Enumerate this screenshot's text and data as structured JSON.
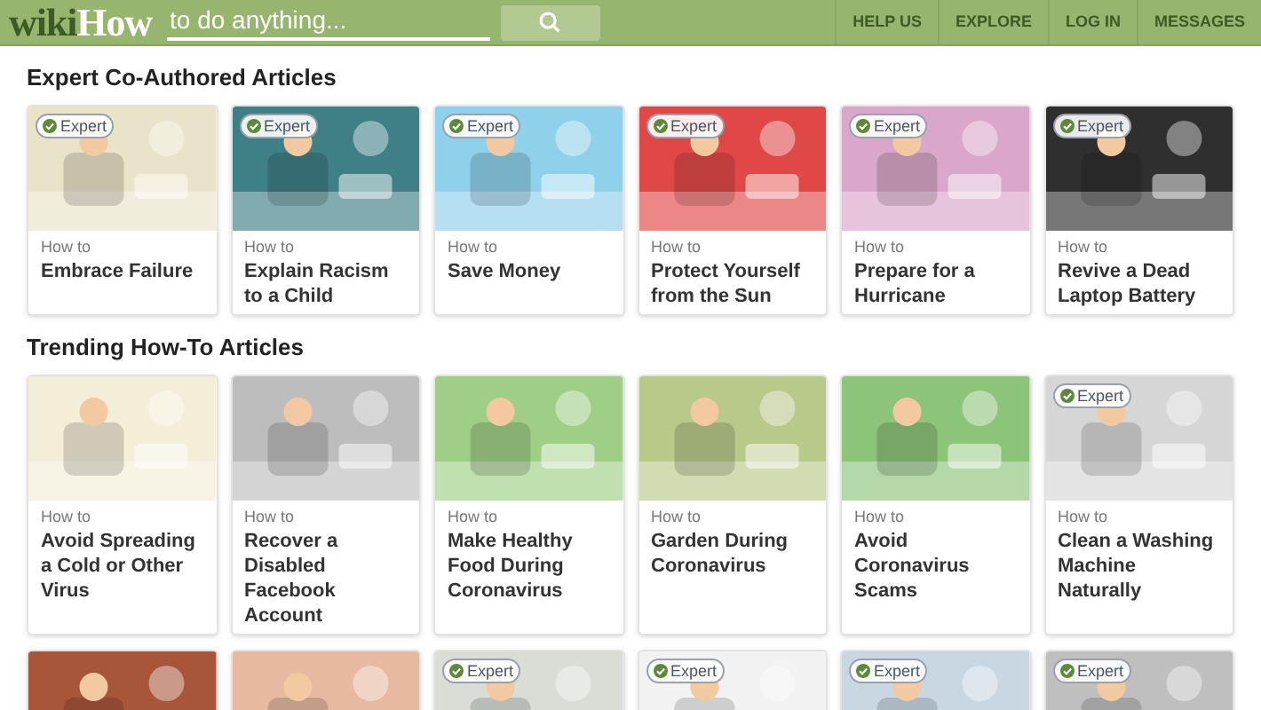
{
  "header": {
    "logo_dark": "wiki",
    "logo_light": "How",
    "search": {
      "placeholder": "to do anything..."
    },
    "nav": [
      "HELP US",
      "EXPLORE",
      "LOG IN",
      "MESSAGES"
    ]
  },
  "sections": [
    {
      "title": "Expert Co-Authored Articles",
      "cards": [
        {
          "image": {
            "kind": "picture"
          },
          "badge": "Expert",
          "prefix": "How to",
          "title": "Embrace Failure"
        },
        {
          "image": {
            "kind": "picture"
          },
          "badge": "Expert",
          "prefix": "How to",
          "title": "Explain Racism to a Child"
        },
        {
          "image": {
            "kind": "picture"
          },
          "badge": "Expert",
          "prefix": "How to",
          "title": "Save Money"
        },
        {
          "image": {
            "kind": "picture"
          },
          "badge": "Expert",
          "prefix": "How to",
          "title": "Protect Yourself from the Sun"
        },
        {
          "image": {
            "kind": "picture"
          },
          "badge": "Expert",
          "prefix": "How to",
          "title": "Prepare for a Hurricane"
        },
        {
          "image": {
            "kind": "picture"
          },
          "badge": "Expert",
          "prefix": "How to",
          "title": "Revive a Dead Laptop Battery"
        }
      ]
    },
    {
      "title": "Trending How-To Articles",
      "cards": [
        {
          "image": {
            "kind": "picture"
          },
          "prefix": "How to",
          "title": "Avoid Spreading a Cold or Other Virus"
        },
        {
          "image": {
            "kind": "picture"
          },
          "prefix": "How to",
          "title": "Recover a Disabled Facebook Account"
        },
        {
          "image": {
            "kind": "picture"
          },
          "prefix": "How to",
          "title": "Make Healthy Food During Coronavirus"
        },
        {
          "image": {
            "kind": "picture"
          },
          "prefix": "How to",
          "title": "Garden During Coronavirus"
        },
        {
          "image": {
            "kind": "picture"
          },
          "prefix": "How to",
          "title": "Avoid Coronavirus Scams"
        },
        {
          "image": {
            "kind": "picture"
          },
          "badge": "Expert",
          "prefix": "How to",
          "title": "Clean a Washing Machine Naturally"
        }
      ]
    },
    {
      "cards": [
        {
          "image": {
            "kind": "picture"
          }
        },
        {
          "image": {
            "kind": "picture"
          }
        },
        {
          "image": {
            "kind": "picture"
          },
          "badge": "Expert"
        },
        {
          "image": {
            "kind": "picture"
          },
          "badge": "Expert"
        },
        {
          "image": {
            "kind": "picture"
          },
          "badge": "Expert"
        },
        {
          "image": {
            "kind": "picture"
          },
          "badge": "Expert"
        }
      ]
    }
  ]
}
